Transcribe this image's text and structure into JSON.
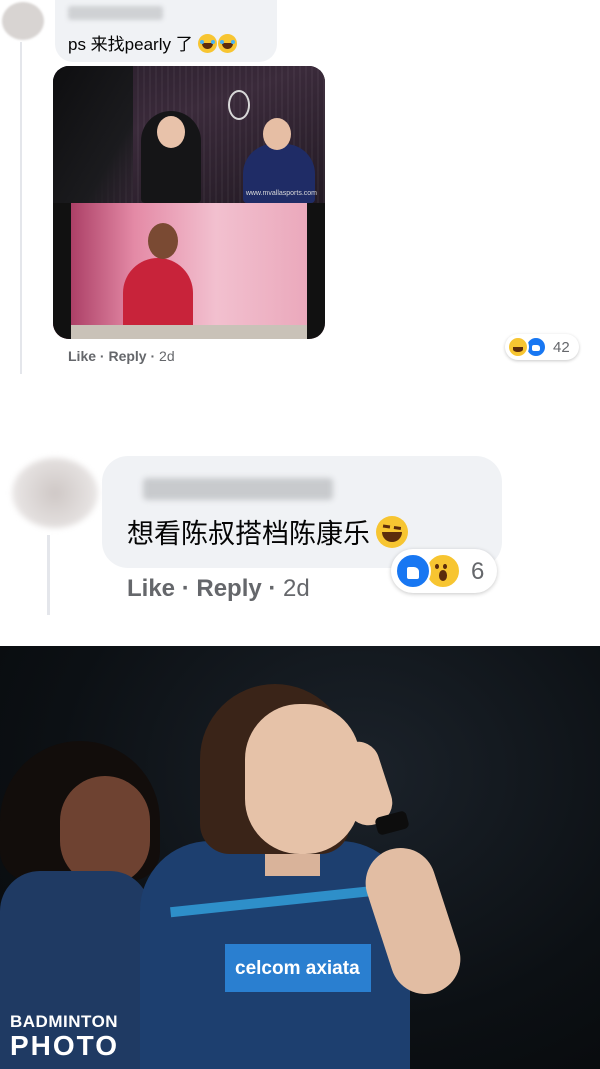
{
  "comment_1": {
    "text": "ps 来找pearly 了",
    "emojis": [
      "laughing-tears",
      "laughing-tears"
    ],
    "actions": {
      "like": "Like",
      "separator": " · ",
      "reply": "Reply",
      "time": "2d"
    },
    "reactions": {
      "types": [
        "haha",
        "like"
      ],
      "count": "42"
    },
    "image": {
      "caption": "www.mvallasports.com"
    }
  },
  "comment_2": {
    "text": "想看陈叔搭档陈康乐",
    "emoji": "grinning-squinting",
    "actions": {
      "like": "Like",
      "separator": " · ",
      "reply": "Reply",
      "time": "2d"
    },
    "reactions": {
      "types": [
        "like",
        "wow"
      ],
      "count": "6"
    }
  },
  "photo": {
    "sponsor": "celcom axiata",
    "watermark_line1": "BADMINTON",
    "watermark_line2": "PHOTO"
  },
  "colors": {
    "bubble": "#f0f2f5",
    "meta_text": "#65676b",
    "like_blue": "#1877f2",
    "emoji_yellow": "#f7c531"
  }
}
